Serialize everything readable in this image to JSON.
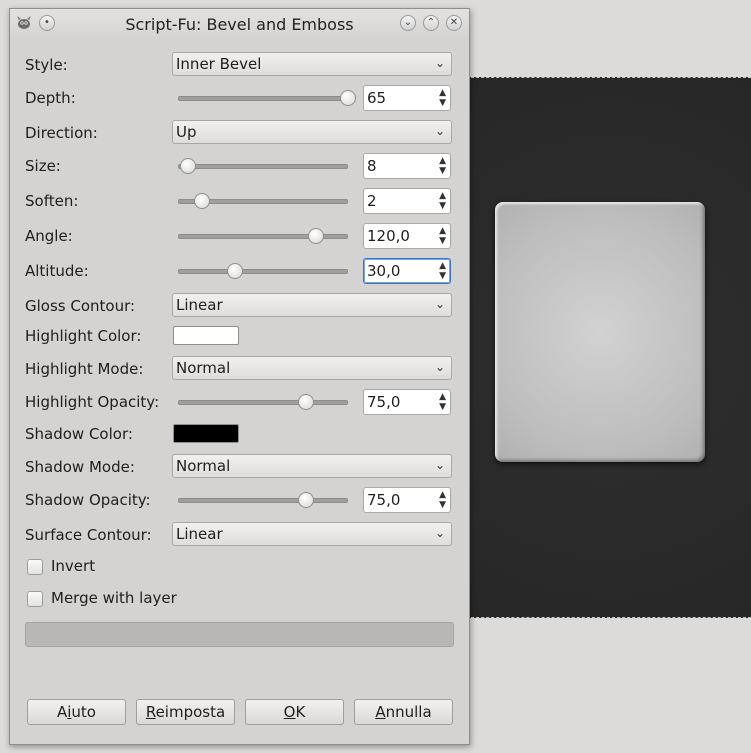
{
  "window": {
    "title": "Script-Fu: Bevel and Emboss"
  },
  "fields": {
    "style": {
      "label": "Style:",
      "value": "Inner Bevel"
    },
    "depth": {
      "label": "Depth:",
      "value": "65",
      "level": 1.0
    },
    "direction": {
      "label": "Direction:",
      "value": "Up"
    },
    "size": {
      "label": "Size:",
      "value": "8",
      "level": 0.05
    },
    "soften": {
      "label": "Soften:",
      "value": "2",
      "level": 0.13
    },
    "angle": {
      "label": "Angle:",
      "value": "120,0",
      "level": 0.81
    },
    "altitude": {
      "label": "Altitude:",
      "value": "30,0",
      "level": 0.33
    },
    "gloss_contour": {
      "label": "Gloss Contour:",
      "value": "Linear"
    },
    "highlight_color": {
      "label": "Highlight Color:",
      "color": "#ffffff"
    },
    "highlight_mode": {
      "label": "Highlight Mode:",
      "value": "Normal"
    },
    "highlight_opacity": {
      "label": "Highlight Opacity:",
      "value": "75,0",
      "level": 0.75
    },
    "shadow_color": {
      "label": "Shadow Color:",
      "color": "#000000"
    },
    "shadow_mode": {
      "label": "Shadow Mode:",
      "value": "Normal"
    },
    "shadow_opacity": {
      "label": "Shadow Opacity:",
      "value": "75,0",
      "level": 0.75
    },
    "surface_contour": {
      "label": "Surface Contour:",
      "value": "Linear"
    }
  },
  "checkboxes": {
    "invert": {
      "label": "Invert",
      "checked": false
    },
    "merge": {
      "label": "Merge with layer",
      "checked": false
    }
  },
  "buttons": {
    "help": {
      "prefix": "A",
      "mnemonic": "i",
      "rest": "uto"
    },
    "reset": {
      "prefix": "",
      "mnemonic": "R",
      "rest": "eimposta"
    },
    "ok": {
      "prefix": "",
      "mnemonic": "O",
      "rest": "K"
    },
    "cancel": {
      "prefix": "",
      "mnemonic": "A",
      "rest": "nnulla"
    }
  },
  "icons": {
    "app": "gimp-wilber-icon",
    "menu": "window-menu-icon",
    "minimize": "chevron-down-icon",
    "maximize": "chevron-up-icon",
    "close": "close-icon",
    "combo": "chevron-down-icon"
  }
}
